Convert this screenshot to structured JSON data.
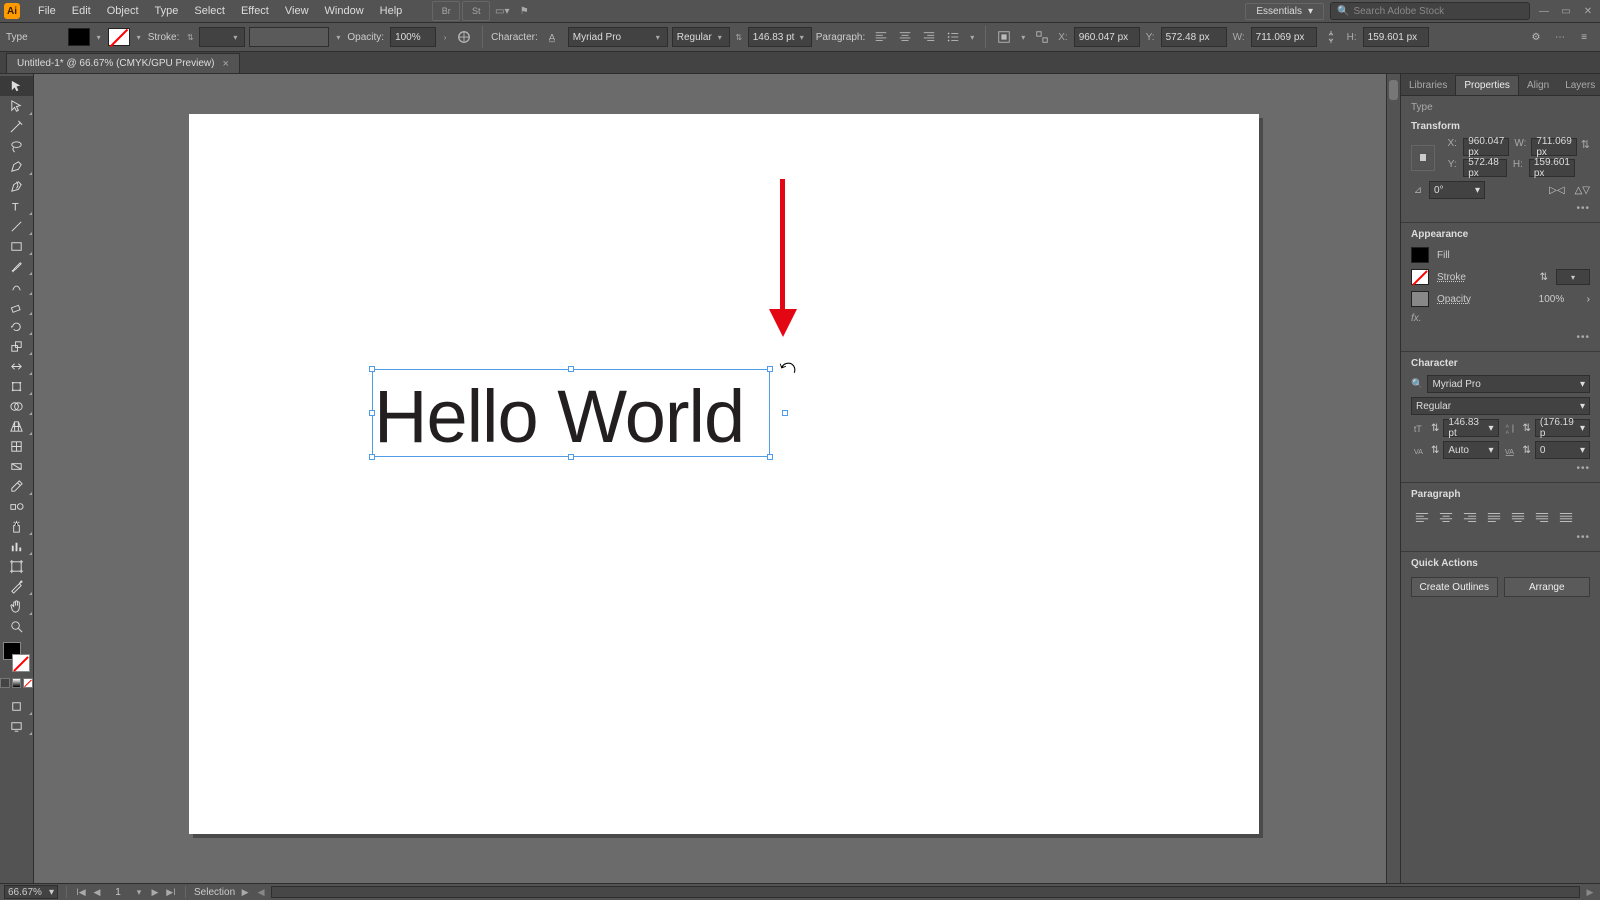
{
  "menu": {
    "items": [
      "File",
      "Edit",
      "Object",
      "Type",
      "Select",
      "Effect",
      "View",
      "Window",
      "Help"
    ],
    "workspace": "Essentials",
    "search_placeholder": "Search Adobe Stock"
  },
  "control": {
    "context_label": "Type",
    "stroke_label": "Stroke:",
    "opacity_label": "Opacity:",
    "opacity_value": "100%",
    "character_label": "Character:",
    "font_family": "Myriad Pro",
    "font_style": "Regular",
    "font_size": "146.83 pt",
    "paragraph_label": "Paragraph:",
    "x_label": "X:",
    "x_value": "960.047 px",
    "y_label": "Y:",
    "y_value": "572.48 px",
    "w_label": "W:",
    "w_value": "711.069 px",
    "h_label": "H:",
    "h_value": "159.601 px"
  },
  "tab": {
    "title": "Untitled-1* @ 66.67% (CMYK/GPU Preview)"
  },
  "canvas": {
    "text_content": "Hello World"
  },
  "panel": {
    "tabs": [
      "Libraries",
      "Properties",
      "Align",
      "Layers"
    ],
    "active_tab": 1,
    "selection_kind": "Type",
    "sections": {
      "transform": {
        "title": "Transform",
        "x": "960.047 px",
        "y": "572.48 px",
        "w": "711.069 px",
        "h": "159.601 px",
        "rotate": "0°"
      },
      "appearance": {
        "title": "Appearance",
        "fill_label": "Fill",
        "stroke_label": "Stroke",
        "opacity_label": "Opacity",
        "opacity_value": "100%",
        "fx_label": "fx."
      },
      "character": {
        "title": "Character",
        "font_family": "Myriad Pro",
        "font_style": "Regular",
        "font_size": "146.83 pt",
        "leading": "(176.19 p",
        "kerning": "Auto",
        "tracking": "0"
      },
      "paragraph": {
        "title": "Paragraph"
      },
      "quick_actions": {
        "title": "Quick Actions",
        "btn1": "Create Outlines",
        "btn2": "Arrange"
      }
    }
  },
  "status": {
    "zoom": "66.67%",
    "artboard": "1",
    "tool": "Selection"
  }
}
